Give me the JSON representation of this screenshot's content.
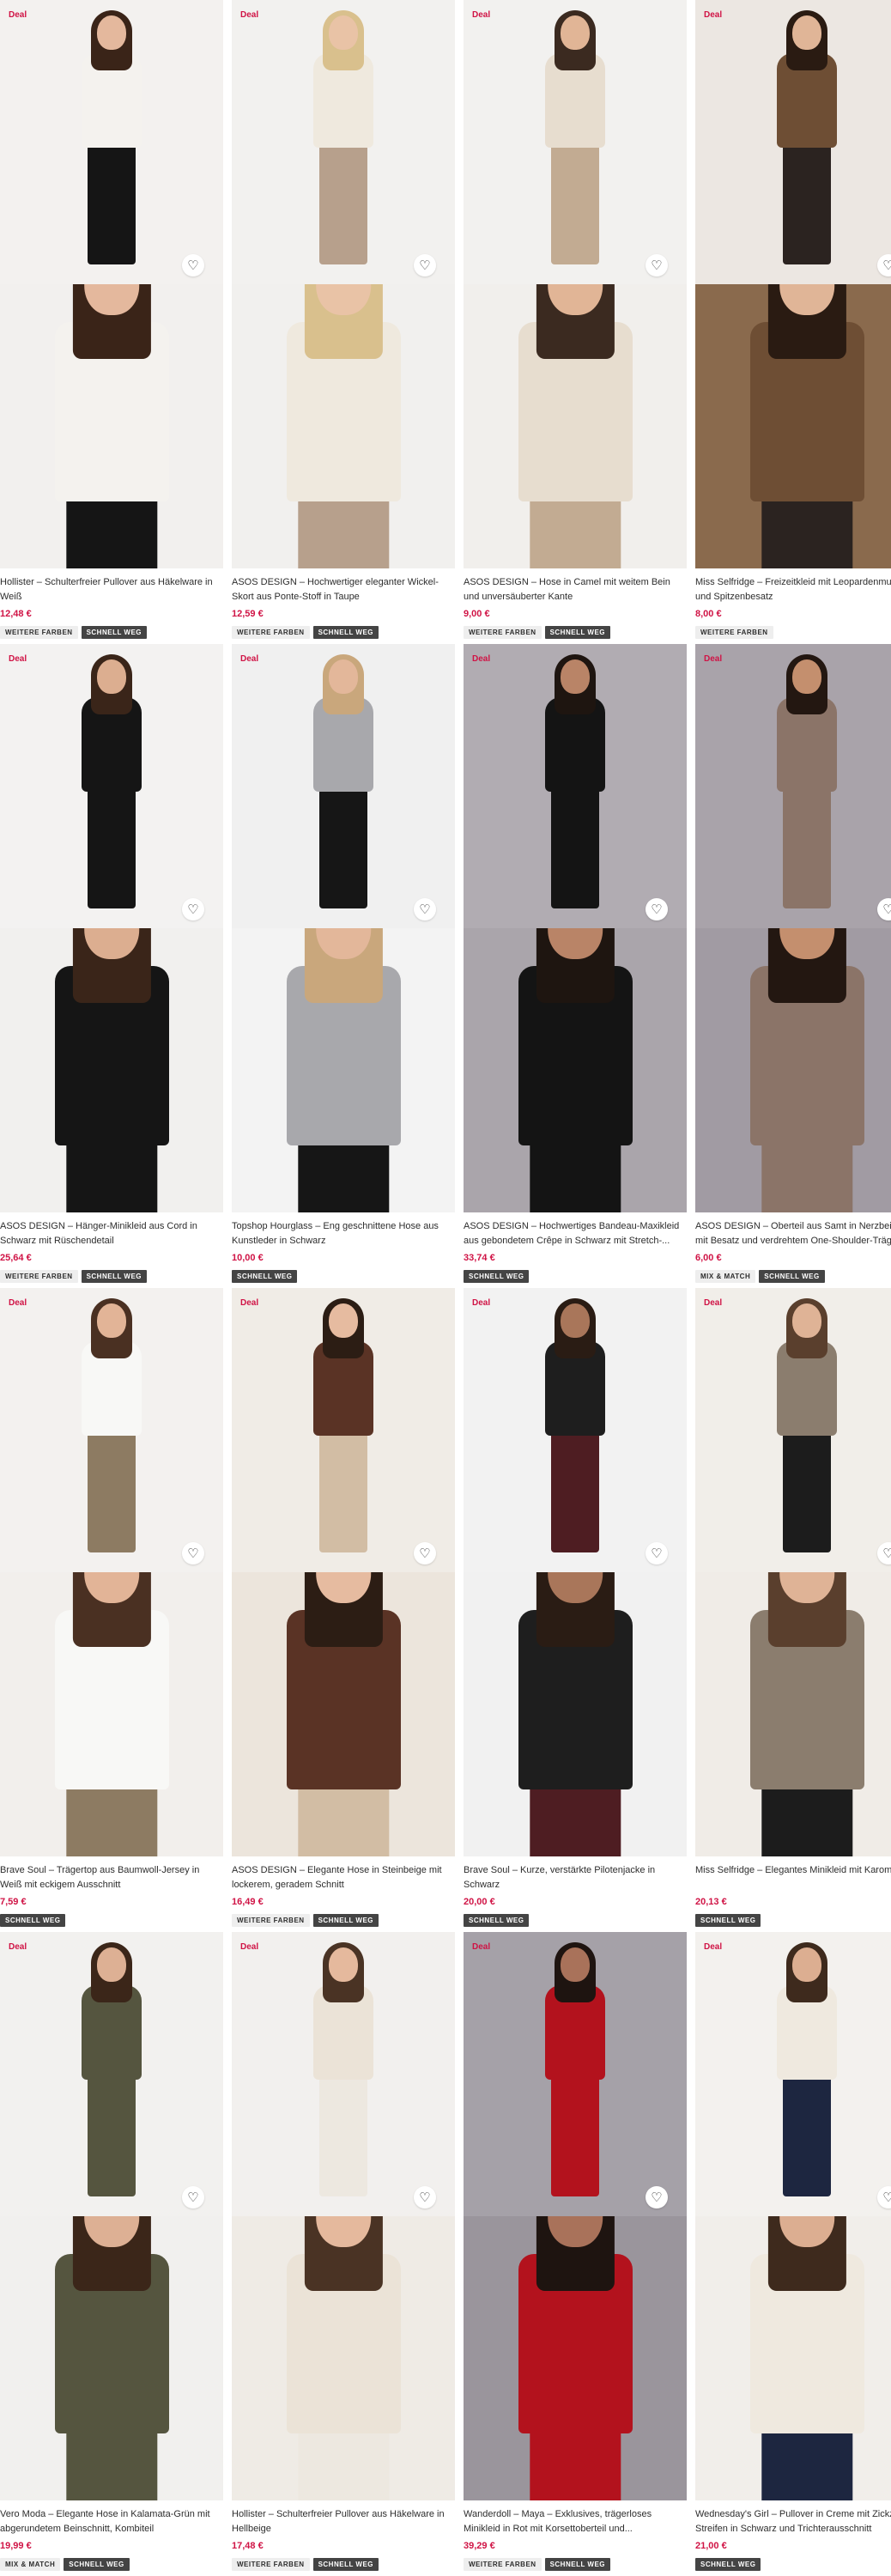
{
  "ui": {
    "deal_label": "Deal",
    "heart_glyph": "♡"
  },
  "products": [
    {
      "deal": true,
      "title": "Hollister – Schulterfreier Pullover aus Häkelware in Weiß",
      "price": "12,48 €",
      "tags": [
        "WEITERE FARBEN",
        "SCHNELL WEG"
      ],
      "colors": {
        "bg": "#f3f1ef",
        "bg2": "#f2f0ee",
        "hair": "#3a2418",
        "skin": "#e4b89d",
        "top": "#f4f2ee",
        "bottom": "#151515"
      }
    },
    {
      "deal": true,
      "title": "ASOS DESIGN – Hochwertiger eleganter Wickel-Skort aus Ponte-Stoff in Taupe",
      "price": "12,59 €",
      "tags": [
        "WEITERE FARBEN",
        "SCHNELL WEG"
      ],
      "colors": {
        "bg": "#f2f1ef",
        "bg2": "#f1f0ee",
        "hair": "#d9c08d",
        "skin": "#e9c3a6",
        "top": "#efe9de",
        "bottom": "#b7a08c"
      }
    },
    {
      "deal": true,
      "title": "ASOS DESIGN – Hose in Camel mit weitem Bein und unversäuberter Kante",
      "price": "9,00 €",
      "tags": [
        "WEITERE FARBEN",
        "SCHNELL WEG"
      ],
      "colors": {
        "bg": "#f2f1ef",
        "bg2": "#f1efec",
        "hair": "#3b2a20",
        "skin": "#e1b596",
        "top": "#e7ddcf",
        "bottom": "#c2ab92"
      }
    },
    {
      "deal": true,
      "title": "Miss Selfridge – Freizeitkleid mit Leopardenmuster und Spitzenbesatz",
      "price": "8,00 €",
      "tags": [
        "WEITERE FARBEN"
      ],
      "colors": {
        "bg": "#ece7e2",
        "bg2": "#8a6a4d",
        "hair": "#2a1b12",
        "skin": "#e0b597",
        "top": "#6e4e34",
        "bottom": "#2b2320"
      }
    },
    {
      "deal": true,
      "title": "ASOS DESIGN – Hänger-Minikleid aus Cord in Schwarz mit Rüschendetail",
      "price": "25,64 €",
      "tags": [
        "WEITERE FARBEN",
        "SCHNELL WEG"
      ],
      "colors": {
        "bg": "#f3f2f1",
        "bg2": "#f1f0ee",
        "hair": "#3a2519",
        "skin": "#dcae90",
        "top": "#151515",
        "bottom": "#151515"
      }
    },
    {
      "deal": true,
      "title": "Topshop Hourglass – Eng geschnittene Hose aus Kunstleder in Schwarz",
      "price": "10,00 €",
      "tags": [
        "SCHNELL WEG"
      ],
      "colors": {
        "bg": "#f0f0f0",
        "bg2": "#f3f3f3",
        "hair": "#c9a77c",
        "skin": "#e3b79a",
        "top": "#a8a8ac",
        "bottom": "#161616"
      }
    },
    {
      "deal": true,
      "title": "ASOS DESIGN – Hochwertiges Bandeau-Maxikleid aus gebondetem Crêpe in Schwarz mit Stretch-...",
      "price": "33,74 €",
      "tags": [
        "SCHNELL WEG"
      ],
      "colors": {
        "bg": "#b1acb2",
        "bg2": "#aaa5ab",
        "hair": "#1e1510",
        "skin": "#b98467",
        "top": "#141414",
        "bottom": "#141414"
      }
    },
    {
      "deal": true,
      "title": "ASOS DESIGN – Oberteil aus Samt in Nerzbeige mit Besatz und verdrehtem One-Shoulder-Träger",
      "price": "6,00 €",
      "tags": [
        "MIX & MATCH",
        "SCHNELL WEG"
      ],
      "colors": {
        "bg": "#a9a3aa",
        "bg2": "#a19ba3",
        "hair": "#231711",
        "skin": "#c48f6e",
        "top": "#8b7468",
        "bottom": "#8b7468"
      }
    },
    {
      "deal": true,
      "title": "Brave Soul – Trägertop aus Baumwoll-Jersey in Weiß mit eckigem Ausschnitt",
      "price": "7,59 €",
      "tags": [
        "SCHNELL WEG"
      ],
      "colors": {
        "bg": "#f3f1ef",
        "bg2": "#f2efec",
        "hair": "#4a3022",
        "skin": "#e2b497",
        "top": "#f8f8f6",
        "bottom": "#8d7b62"
      }
    },
    {
      "deal": true,
      "title": "ASOS DESIGN – Elegante Hose in Steinbeige mit lockerem, geradem Schnitt",
      "price": "16,49 €",
      "tags": [
        "WEITERE FARBEN",
        "SCHNELL WEG"
      ],
      "colors": {
        "bg": "#f0ece6",
        "bg2": "#ece5dc",
        "hair": "#2c1d14",
        "skin": "#e6bba0",
        "top": "#5a3325",
        "bottom": "#d2bda4"
      }
    },
    {
      "deal": true,
      "title": "Brave Soul – Kurze, verstärkte Pilotenjacke in Schwarz",
      "price": "20,00 €",
      "tags": [
        "SCHNELL WEG"
      ],
      "colors": {
        "bg": "#f2f2f2",
        "bg2": "#f1f1f1",
        "hair": "#2a1c14",
        "skin": "#a9765a",
        "top": "#1e1e1e",
        "bottom": "#4e1d22"
      }
    },
    {
      "deal": true,
      "title": "Miss Selfridge – Elegantes Minikleid mit Karomuster",
      "price": "20,13 €",
      "tags": [
        "SCHNELL WEG"
      ],
      "colors": {
        "bg": "#f1eee9",
        "bg2": "#f0ece7",
        "hair": "#5a3f2d",
        "skin": "#dfb396",
        "top": "#8b7d6e",
        "bottom": "#1c1c1c"
      }
    },
    {
      "deal": true,
      "title": "Vero Moda – Elegante Hose in Kalamata-Grün mit abgerundetem Beinschnitt, Kombiteil",
      "price": "19,99 €",
      "tags": [
        "MIX & MATCH",
        "SCHNELL WEG"
      ],
      "colors": {
        "bg": "#f2f1ef",
        "bg2": "#f1f0ee",
        "hair": "#3b2619",
        "skin": "#ddb094",
        "top": "#55553f",
        "bottom": "#55553f"
      }
    },
    {
      "deal": true,
      "title": "Hollister – Schulterfreier Pullover aus Häkelware in Hellbeige",
      "price": "17,48 €",
      "tags": [
        "WEITERE FARBEN",
        "SCHNELL WEG"
      ],
      "colors": {
        "bg": "#f2f0ee",
        "bg2": "#efebe5",
        "hair": "#4a3324",
        "skin": "#e5b99d",
        "top": "#ebe3d7",
        "bottom": "#ede8e0"
      }
    },
    {
      "deal": true,
      "title": "Wanderdoll – Maya – Exklusives, trägerloses Minikleid in Rot mit Korsettoberteil und...",
      "price": "39,29 €",
      "tags": [
        "WEITERE FARBEN",
        "SCHNELL WEG"
      ],
      "colors": {
        "bg": "#a5a1a8",
        "bg2": "#9a959c",
        "hair": "#1e1410",
        "skin": "#a9725a",
        "top": "#b3121d",
        "bottom": "#b3121d"
      }
    },
    {
      "deal": true,
      "title": "Wednesday's Girl – Pullover in Creme mit Zickzack-Streifen in Schwarz und Trichterausschnitt",
      "price": "21,00 €",
      "tags": [
        "SCHNELL WEG"
      ],
      "colors": {
        "bg": "#f3f1ee",
        "bg2": "#f1eeea",
        "hair": "#3e2a1d",
        "skin": "#dcae91",
        "top": "#efe9df",
        "bottom": "#1d2640"
      }
    }
  ]
}
